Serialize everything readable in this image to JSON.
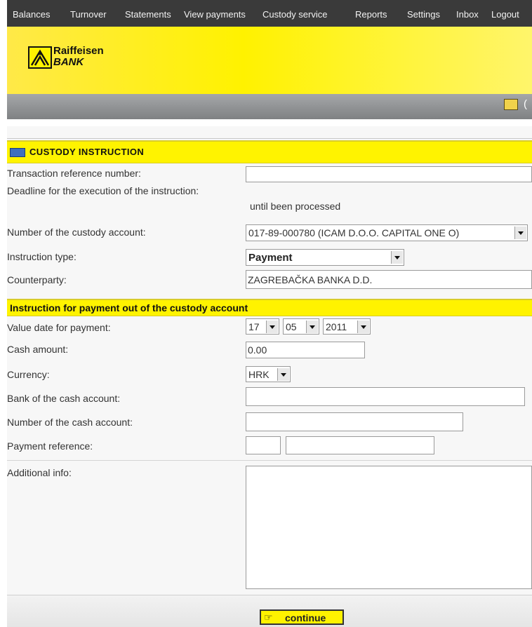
{
  "nav": {
    "items": [
      "Balances",
      "Turnover",
      "Statements",
      "View payments",
      "Custody service",
      "Reports",
      "Settings",
      "Inbox",
      "Logout"
    ]
  },
  "brand": {
    "name_line1": "Raiffeisen",
    "name_line2": "BANK"
  },
  "header": {
    "right_text": "("
  },
  "colors": {
    "brand_yellow": "#fff200",
    "nav_bg": "#3a3a3a",
    "section_bg": "#fff300"
  },
  "custody": {
    "title": "CUSTODY INSTRUCTION",
    "fields": {
      "trn_ref": {
        "label": "Transaction reference number:",
        "value": ""
      },
      "deadline": {
        "label": "Deadline for the execution of the instruction:",
        "value": "until been processed"
      },
      "account": {
        "label": "Number of the custody account:",
        "value": "017-89-000780 (ICAM D.O.O. CAPITAL ONE O)"
      },
      "instr_type": {
        "label": "Instruction type:",
        "value": "Payment"
      },
      "counterparty": {
        "label": "Counterparty:",
        "value": "ZAGREBAČKA BANKA D.D."
      }
    }
  },
  "payment": {
    "title": "Instruction for payment out of the custody account",
    "fields": {
      "value_date": {
        "label": "Value date for payment:",
        "day": "17",
        "month": "05",
        "year": "2011"
      },
      "cash_amount": {
        "label": "Cash amount:",
        "value": "0.00"
      },
      "currency": {
        "label": "Currency:",
        "value": "HRK"
      },
      "bank": {
        "label": "Bank of the cash account:",
        "value": ""
      },
      "cash_account": {
        "label": "Number of the cash account:",
        "value": ""
      },
      "pay_ref": {
        "label": "Payment reference:",
        "value1": "",
        "value2": ""
      },
      "additional": {
        "label": "Additional info:",
        "value": ""
      }
    }
  },
  "actions": {
    "continue_label": "continue",
    "continue_icon": "pointing-hand-icon"
  }
}
